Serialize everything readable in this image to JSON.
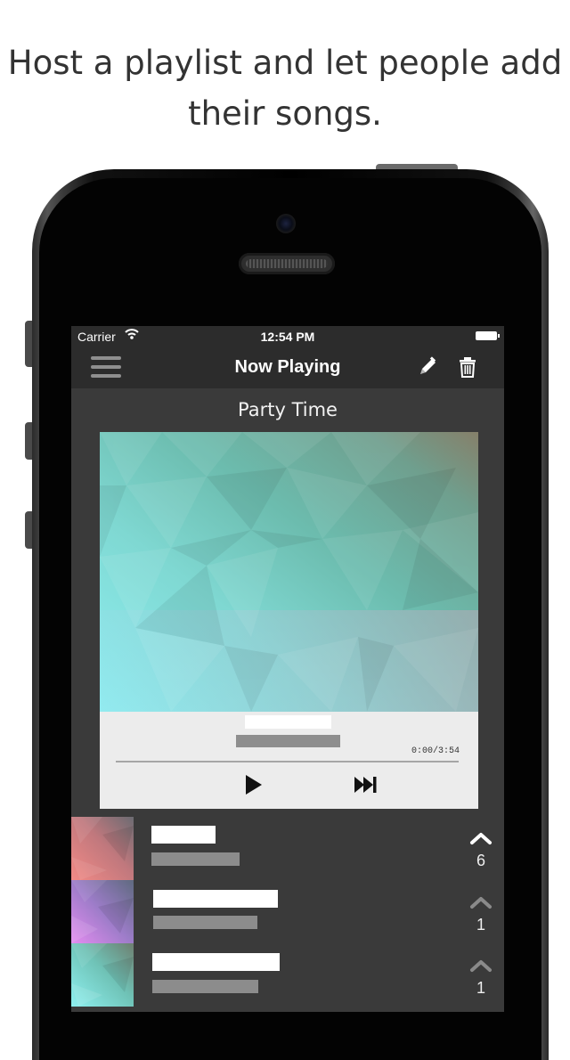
{
  "headline": {
    "line1": "Host a playlist and let people add",
    "line2": "their songs."
  },
  "status_bar": {
    "carrier": "Carrier",
    "time": "12:54 PM"
  },
  "nav": {
    "title": "Now Playing",
    "icons": [
      "menu-icon",
      "pencil-icon",
      "trash-icon"
    ]
  },
  "playlist": {
    "name": "Party Time"
  },
  "now_playing": {
    "time_display": "0:00/3:54",
    "progress": 0
  },
  "queue": [
    {
      "votes": "6",
      "upvoted": true
    },
    {
      "votes": "1",
      "upvoted": false
    },
    {
      "votes": "1",
      "upvoted": false
    }
  ],
  "colors": {
    "screen_bg": "#3a3a3a",
    "bar_bg": "#2c2c2c",
    "player_bg": "#ececec"
  }
}
